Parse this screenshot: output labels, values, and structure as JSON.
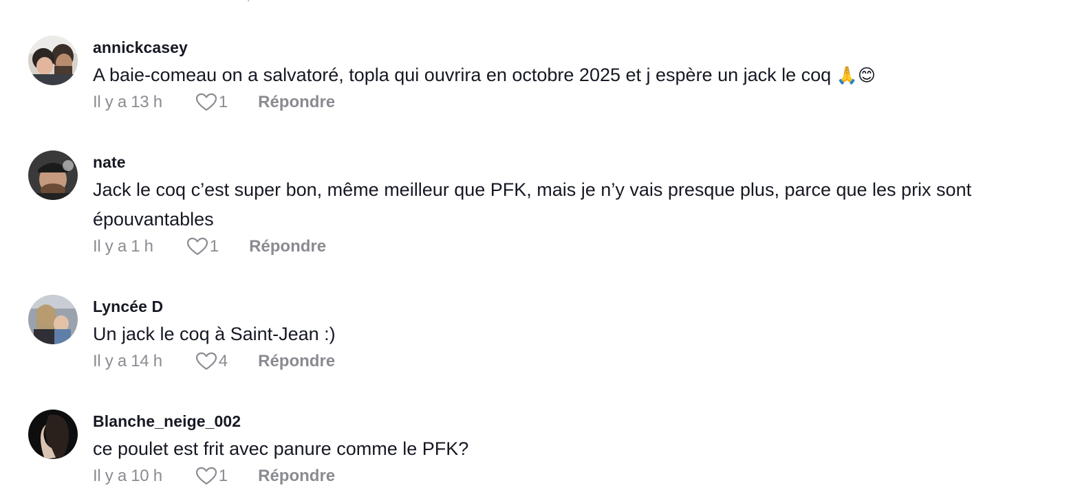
{
  "comments": [
    {
      "username": "annickcasey",
      "text": "A baie-comeau on a salvatoré, topla qui ouvrira en octobre 2025 et j espère un jack le coq",
      "emoji": "🙏😊",
      "time": "Il y a 13 h",
      "likes": "1",
      "reply_label": "Répondre",
      "avatar_icon": "couple-photo-avatar"
    },
    {
      "username": "nate",
      "text": "Jack le coq c’est super bon, même meilleur que PFK, mais je n’y vais presque plus, parce que les prix sont épouvantables",
      "time": "Il y a 1 h",
      "likes": "1",
      "reply_label": "Répondre",
      "avatar_icon": "man-cap-photo-avatar"
    },
    {
      "username": "Lyncée D",
      "text": "Un jack le coq à Saint-Jean :)",
      "time": "Il y a 14 h",
      "likes": "4",
      "reply_label": "Répondre",
      "avatar_icon": "woman-child-photo-avatar"
    },
    {
      "username": "Blanche_neige_002",
      "text": "ce poulet est frit avec panure comme le PFK?",
      "time": "Il y a 10 h",
      "likes": "1",
      "reply_label": "Répondre",
      "avatar_icon": "woman-profile-photo-avatar"
    }
  ],
  "colors": {
    "text": "#161823",
    "secondary": "#8a8b91"
  }
}
